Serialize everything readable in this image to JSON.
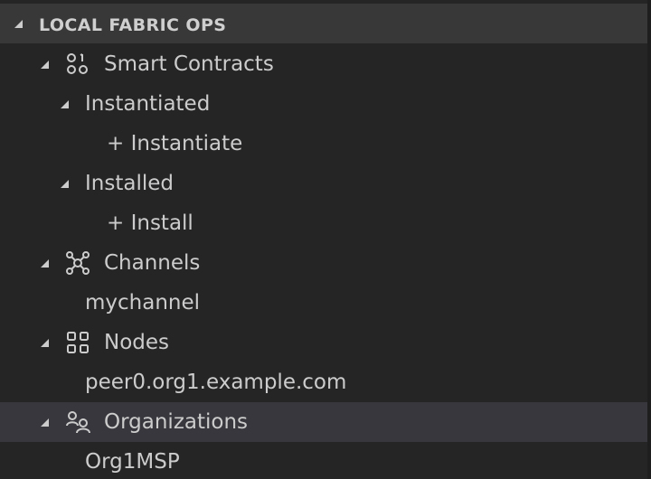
{
  "section": {
    "title": "LOCAL FABRIC OPS"
  },
  "tree": {
    "smart_contracts": {
      "label": "Smart Contracts",
      "icon": "smart-contracts-icon",
      "instantiated": {
        "label": "Instantiated",
        "action": "+ Instantiate"
      },
      "installed": {
        "label": "Installed",
        "action": "+ Install"
      }
    },
    "channels": {
      "label": "Channels",
      "icon": "channels-network-icon",
      "items": [
        "mychannel"
      ]
    },
    "nodes": {
      "label": "Nodes",
      "icon": "nodes-grid-icon",
      "items": [
        "peer0.org1.example.com"
      ]
    },
    "organizations": {
      "label": "Organizations",
      "icon": "organizations-people-icon",
      "items": [
        "Org1MSP"
      ]
    }
  },
  "colors": {
    "background": "#252526",
    "header": "#383838",
    "selected_row": "#37373d",
    "text": "#cccccc"
  }
}
